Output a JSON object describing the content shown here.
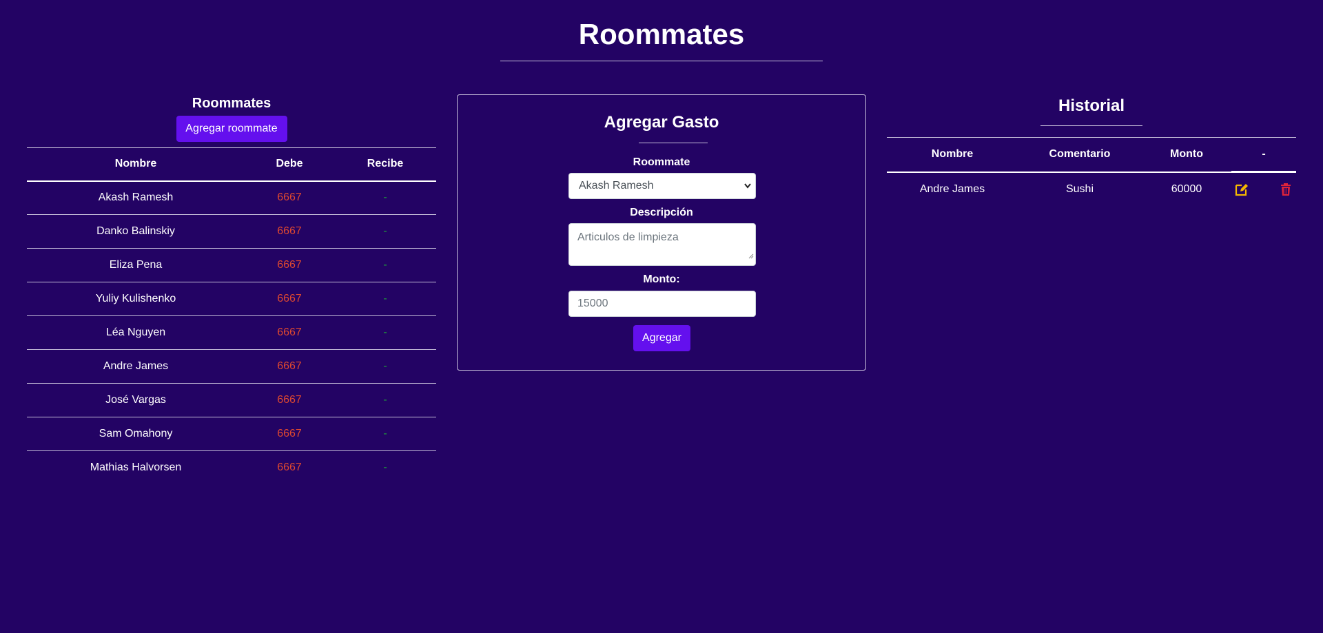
{
  "page": {
    "title": "Roommates"
  },
  "roommates_panel": {
    "heading": "Roommates",
    "add_button": "Agregar roommate",
    "columns": [
      "Nombre",
      "Debe",
      "Recibe"
    ],
    "rows": [
      {
        "nombre": "Akash Ramesh",
        "debe": "6667",
        "recibe": "-"
      },
      {
        "nombre": "Danko Balinskiy",
        "debe": "6667",
        "recibe": "-"
      },
      {
        "nombre": "Eliza Pena",
        "debe": "6667",
        "recibe": "-"
      },
      {
        "nombre": "Yuliy Kulishenko",
        "debe": "6667",
        "recibe": "-"
      },
      {
        "nombre": "Léa Nguyen",
        "debe": "6667",
        "recibe": "-"
      },
      {
        "nombre": "Andre James",
        "debe": "6667",
        "recibe": "-"
      },
      {
        "nombre": "José Vargas",
        "debe": "6667",
        "recibe": "-"
      },
      {
        "nombre": "Sam Omahony",
        "debe": "6667",
        "recibe": "-"
      },
      {
        "nombre": "Mathias Halvorsen",
        "debe": "6667",
        "recibe": "-"
      }
    ]
  },
  "gasto_form": {
    "title": "Agregar Gasto",
    "roommate_label": "Roommate",
    "roommate_selected": "Akash Ramesh",
    "descripcion_label": "Descripción",
    "descripcion_placeholder": "Articulos de limpieza",
    "monto_label": "Monto:",
    "monto_placeholder": "15000",
    "submit_label": "Agregar"
  },
  "historial": {
    "title": "Historial",
    "columns": [
      "Nombre",
      "Comentario",
      "Monto",
      "-"
    ],
    "rows": [
      {
        "nombre": "Andre James",
        "comentario": "Sushi",
        "monto": "60000"
      }
    ]
  },
  "colors": {
    "background": "#230364",
    "button": "#6410ee",
    "debe": "#e0492f",
    "recibe": "#1f9d3a",
    "edit_icon": "#f5b800",
    "delete_icon": "#e0243a"
  },
  "icons": {
    "edit": "edit-icon",
    "delete": "trash-icon",
    "select": "chevron-down-icon"
  }
}
